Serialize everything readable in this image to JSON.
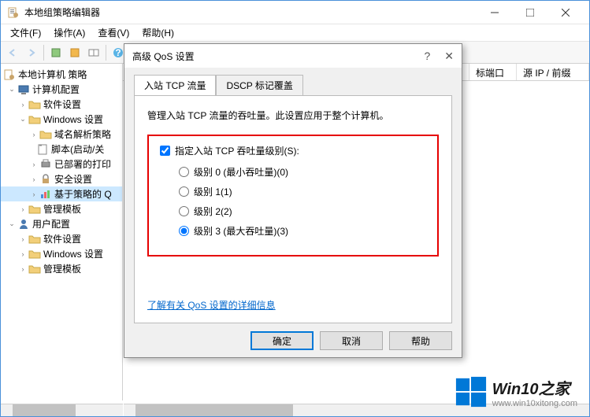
{
  "window": {
    "title": "本地组策略编辑器"
  },
  "menu": {
    "file": "文件(F)",
    "action": "操作(A)",
    "view": "查看(V)",
    "help": "帮助(H)"
  },
  "tree": {
    "root": "本地计算机 策略",
    "computer": "计算机配置",
    "software1": "软件设置",
    "windows": "Windows 设置",
    "dns": "域名解析策略",
    "script": "脚本(启动/关",
    "printer": "已部署的打印",
    "security": "安全设置",
    "qos": "基于策略的 Q",
    "admin1": "管理模板",
    "user": "用户配置",
    "software2": "软件设置",
    "windows2": "Windows 设置",
    "admin2": "管理模板"
  },
  "list_headers": {
    "col1": "标端口",
    "col2": "源 IP / 前缀"
  },
  "dialog": {
    "title": "高级 QoS 设置",
    "tab1": "入站 TCP 流量",
    "tab2": "DSCP 标记覆盖",
    "desc": "管理入站 TCP 流量的吞吐量。此设置应用于整个计算机。",
    "checkbox": "指定入站 TCP 吞吐量级别(S):",
    "radio0": "级别 0 (最小吞吐量)(0)",
    "radio1": "级别 1(1)",
    "radio2": "级别 2(2)",
    "radio3": "级别 3 (最大吞吐量)(3)",
    "link": "了解有关 QoS 设置的详细信息",
    "ok": "确定",
    "cancel": "取消",
    "help": "帮助"
  },
  "watermark": {
    "title": "Win10之家",
    "url": "www.win10xitong.com"
  }
}
